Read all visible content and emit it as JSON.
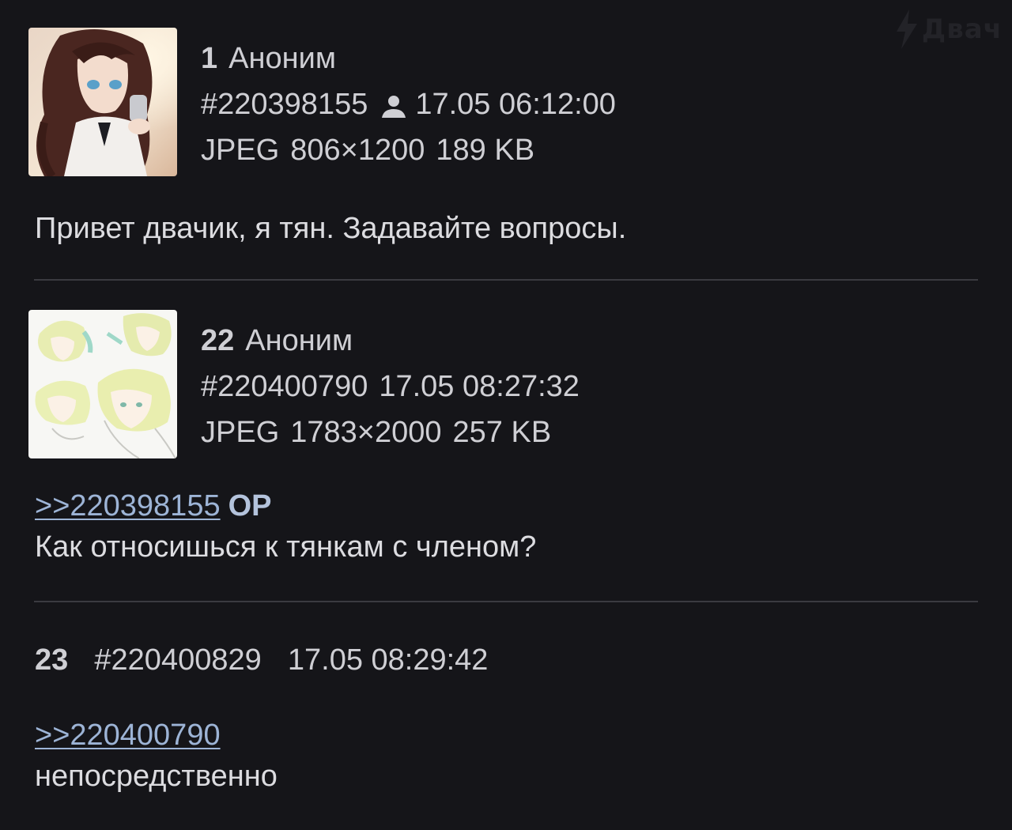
{
  "watermark": {
    "text": "Двач",
    "icon": "lightning-bolt-icon"
  },
  "posts": [
    {
      "number": "1",
      "author": "Аноним",
      "id": "#220398155",
      "has_op_icon": true,
      "op_icon": "person-icon",
      "datetime": "17.05 06:12:00",
      "file_type": "JPEG",
      "file_dims": "806×1200",
      "file_size": "189 KB",
      "text": "Привет двачик, я тян. Задавайте вопросы."
    },
    {
      "number": "22",
      "author": "Аноним",
      "id": "#220400790",
      "datetime": "17.05 08:27:32",
      "file_type": "JPEG",
      "file_dims": "1783×2000",
      "file_size": "257 KB",
      "reply_to": ">>220398155",
      "reply_tag": "OP",
      "text": "Как относишься к тянкам с членом?"
    },
    {
      "number": "23",
      "id": "#220400829",
      "datetime": "17.05 08:29:42",
      "reply_to": ">>220400790",
      "text": "непосредственно"
    }
  ],
  "colors": {
    "background": "#151519",
    "text": "#dcdce0",
    "link": "#9db4d6",
    "divider": "#3a3a40"
  }
}
